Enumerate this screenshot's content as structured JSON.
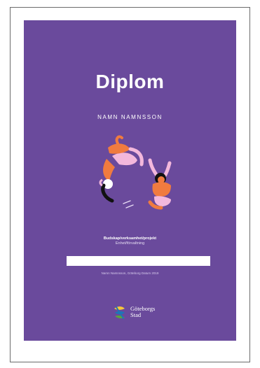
{
  "diploma": {
    "title": "Diplom",
    "recipient": "NAMN NAMNSSON",
    "organization": "Budskap/verksamhet/projekt",
    "unit": "Enhet/förvaltning",
    "signature": "Namn Namnsson, Göteborg Datum 2019",
    "logo": {
      "line1": "Göteborgs",
      "line2": "Stad"
    }
  },
  "colors": {
    "background": "#6a4a9c",
    "figure_orange": "#f07b3f",
    "figure_pink": "#f3b8dc",
    "logo_yellow": "#f6c73a",
    "logo_blue": "#1f75b7",
    "logo_green": "#5aa63b"
  },
  "icons": [
    "jumping-people-illustration",
    "goteborgs-stad-logo-icon"
  ]
}
